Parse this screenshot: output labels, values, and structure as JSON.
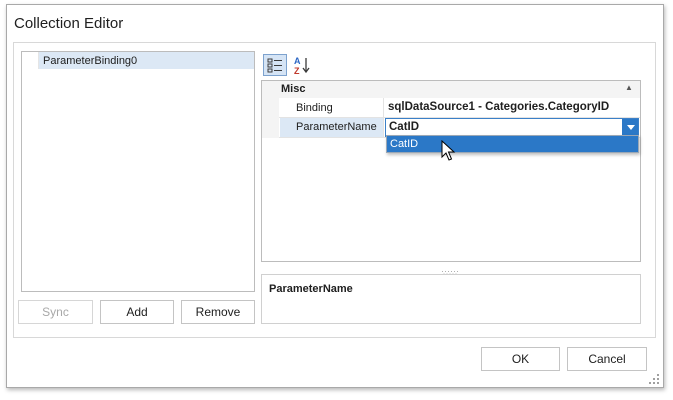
{
  "window": {
    "title": "Collection Editor"
  },
  "collection": {
    "items": [
      {
        "label": "ParameterBinding0"
      }
    ]
  },
  "list_buttons": {
    "sync": "Sync",
    "add": "Add",
    "remove": "Remove"
  },
  "toolbar": {
    "categorized_icon": "categorized-icon",
    "alphabetical_icon": "sort-az-icon"
  },
  "property_grid": {
    "category": "Misc",
    "rows": [
      {
        "name": "Binding",
        "value": "sqlDataSource1 - Categories.CategoryID"
      },
      {
        "name": "ParameterName",
        "value": "CatID"
      }
    ],
    "dropdown_options": [
      "CatID"
    ],
    "description_title": "ParameterName"
  },
  "footer": {
    "ok": "OK",
    "cancel": "Cancel"
  },
  "colors": {
    "accent": "#2b78c7",
    "selection": "#dce8f5"
  }
}
